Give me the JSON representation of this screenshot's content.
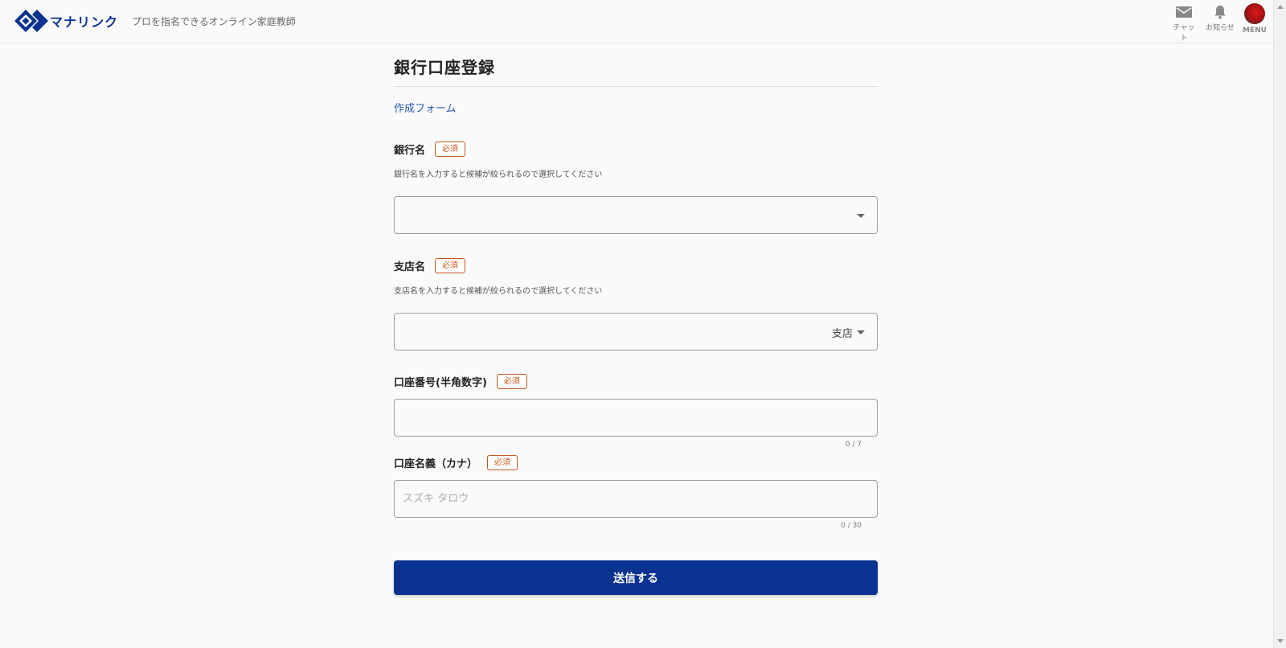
{
  "header": {
    "logo_text": "マナリンク",
    "tagline": "プロを指名できるオンライン家庭教師",
    "chat_label": "チャット",
    "notice_label": "お知らせ",
    "menu_label": "MENU"
  },
  "main": {
    "title": "銀行口座登録",
    "form_link": "作成フォーム",
    "required_badge": "必須",
    "fields": {
      "bank": {
        "label": "銀行名",
        "hint": "銀行名を入力すると候補が絞られるので選択してください",
        "value": ""
      },
      "branch": {
        "label": "支店名",
        "hint": "支店名を入力すると候補が絞られるので選択してください",
        "suffix": "支店",
        "value": ""
      },
      "account_number": {
        "label": "口座番号(半角数字)",
        "value": "",
        "counter": "0 / 7"
      },
      "account_name": {
        "label": "口座名義（カナ）",
        "placeholder": "スズキ タロウ",
        "value": "",
        "counter": "0 / 30"
      }
    },
    "submit_label": "送信する"
  },
  "colors": {
    "brand": "#0a3291",
    "required": "#c2571a",
    "link": "#2a5bb3"
  }
}
